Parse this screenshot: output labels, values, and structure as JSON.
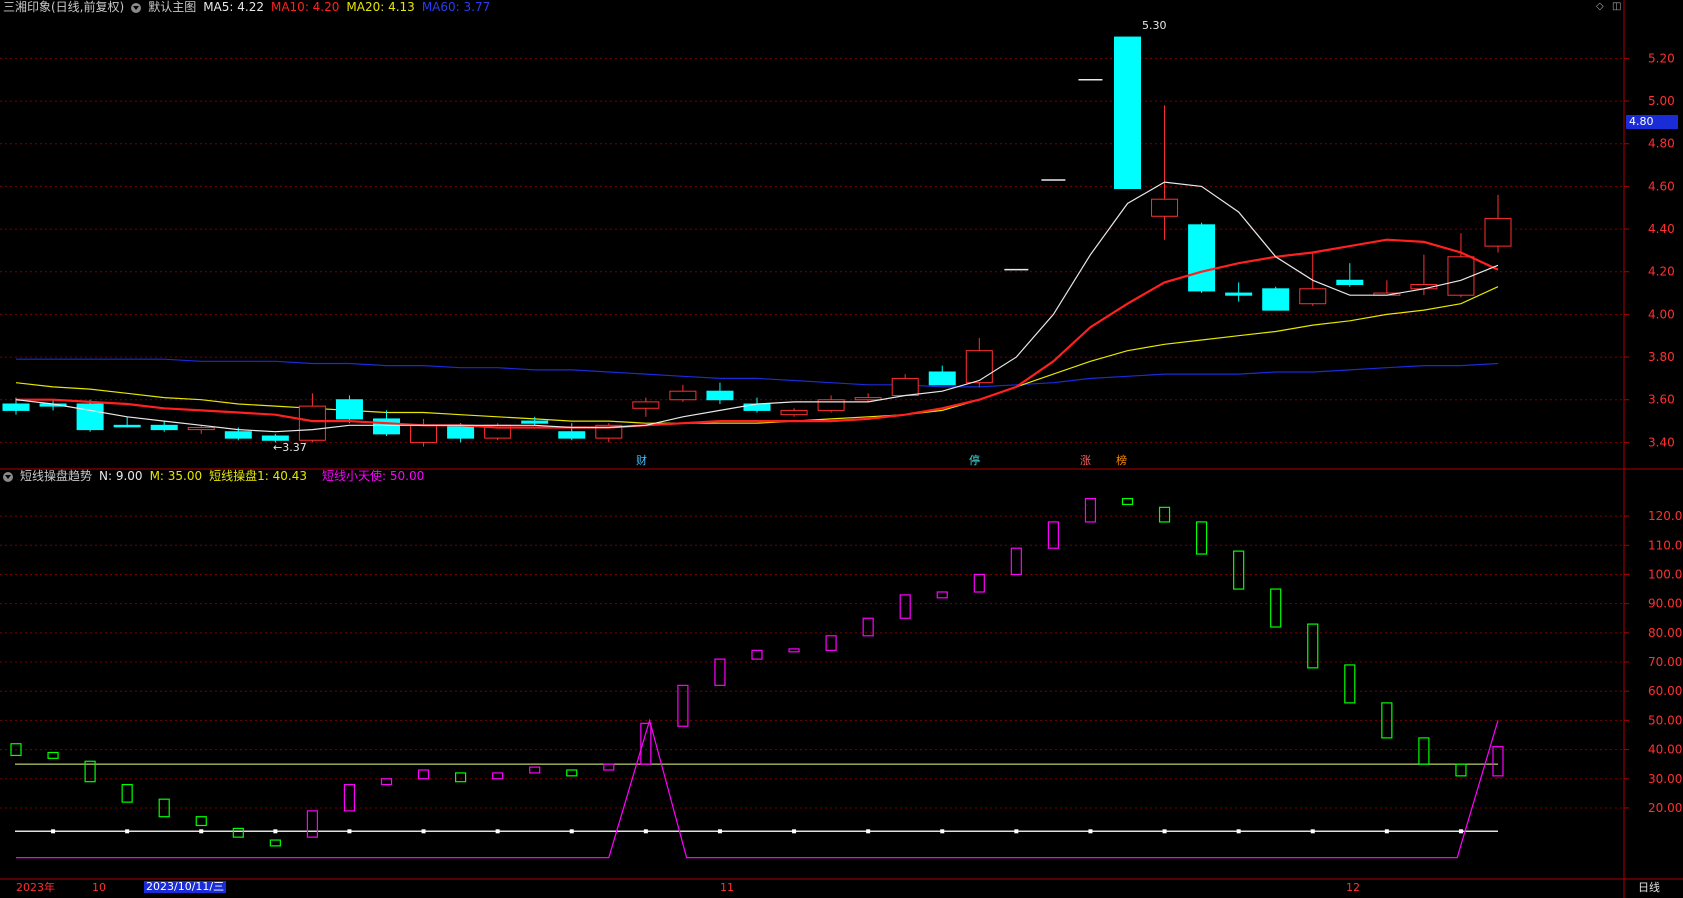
{
  "top_panel": {
    "stock_name": "三湘印象(日线,前复权)",
    "main_chart_label": "默认主图",
    "ma5": "MA5: 4.22",
    "ma10": "MA10: 4.20",
    "ma20": "MA20: 4.13",
    "ma60": "MA60: 3.77",
    "current_price_tag": "4.80",
    "high_label": "5.30",
    "low_label": "←3.37",
    "event_markers": [
      "财",
      "停",
      "涨",
      "榜"
    ]
  },
  "bottom_panel": {
    "indicator_name": "短线操盘趋势",
    "n": "N: 9.00",
    "m": "M: 35.00",
    "trade_line": "短线操盘1: 40.43",
    "angel": "短线小天使: 50.00"
  },
  "time_axis": {
    "labels": [
      "2023年",
      "10",
      "2023/10/11/三",
      "11",
      "12"
    ],
    "period": "日线"
  },
  "colors": {
    "up": "#ff3030",
    "down": "#00ffff",
    "ma5": "#e8e8e8",
    "ma10": "#ff2020",
    "ma20": "#e6e600",
    "ma60": "#1a2bd8",
    "ind_up": "#ff00ff",
    "ind_down": "#00ff00",
    "grid": "#7a0000",
    "axis_text": "#ff3030"
  },
  "chart_data": [
    {
      "type": "candlestick",
      "yticks": [
        3.4,
        3.6,
        3.8,
        4.0,
        4.2,
        4.4,
        4.6,
        4.8,
        5.0,
        5.2
      ],
      "ylim": [
        3.28,
        5.38
      ],
      "candles": [
        [
          3.58,
          3.61,
          3.53,
          3.55
        ],
        [
          3.58,
          3.6,
          3.55,
          3.57
        ],
        [
          3.58,
          3.6,
          3.45,
          3.46
        ],
        [
          3.48,
          3.52,
          3.47,
          3.48
        ],
        [
          3.48,
          3.5,
          3.45,
          3.46
        ],
        [
          3.46,
          3.48,
          3.44,
          3.47
        ],
        [
          3.45,
          3.47,
          3.41,
          3.42
        ],
        [
          3.43,
          3.44,
          3.4,
          3.41
        ],
        [
          3.41,
          3.63,
          3.4,
          3.57
        ],
        [
          3.6,
          3.62,
          3.49,
          3.51
        ],
        [
          3.51,
          3.55,
          3.43,
          3.44
        ],
        [
          3.4,
          3.51,
          3.38,
          3.48
        ],
        [
          3.48,
          3.49,
          3.4,
          3.42
        ],
        [
          3.42,
          3.49,
          3.41,
          3.48
        ],
        [
          3.5,
          3.52,
          3.48,
          3.49
        ],
        [
          3.45,
          3.49,
          3.41,
          3.42
        ],
        [
          3.42,
          3.49,
          3.4,
          3.48
        ],
        [
          3.56,
          3.61,
          3.52,
          3.59
        ],
        [
          3.6,
          3.67,
          3.59,
          3.64
        ],
        [
          3.64,
          3.68,
          3.58,
          3.6
        ],
        [
          3.58,
          3.61,
          3.54,
          3.55
        ],
        [
          3.53,
          3.56,
          3.52,
          3.55
        ],
        [
          3.55,
          3.62,
          3.54,
          3.6
        ],
        [
          3.6,
          3.63,
          3.59,
          3.61
        ],
        [
          3.62,
          3.72,
          3.62,
          3.7
        ],
        [
          3.73,
          3.76,
          3.67,
          3.67
        ],
        [
          3.68,
          3.89,
          3.66,
          3.83
        ],
        [
          4.21,
          4.21,
          4.21,
          4.21
        ],
        [
          4.63,
          4.63,
          4.63,
          4.63
        ],
        [
          5.1,
          5.1,
          5.1,
          5.1
        ],
        [
          5.3,
          5.3,
          4.59,
          4.59
        ],
        [
          4.46,
          4.98,
          4.35,
          4.54
        ],
        [
          4.42,
          4.43,
          4.1,
          4.11
        ],
        [
          4.1,
          4.15,
          4.06,
          4.09
        ],
        [
          4.12,
          4.13,
          4.02,
          4.02
        ],
        [
          4.05,
          4.29,
          4.04,
          4.12
        ],
        [
          4.16,
          4.24,
          4.13,
          4.14
        ],
        [
          4.09,
          4.16,
          4.09,
          4.1
        ],
        [
          4.12,
          4.28,
          4.09,
          4.14
        ],
        [
          4.09,
          4.38,
          4.08,
          4.27
        ],
        [
          4.32,
          4.56,
          4.29,
          4.45
        ]
      ],
      "ma5": [
        3.6,
        3.58,
        3.55,
        3.52,
        3.5,
        3.48,
        3.46,
        3.45,
        3.46,
        3.48,
        3.48,
        3.48,
        3.48,
        3.48,
        3.48,
        3.47,
        3.47,
        3.48,
        3.52,
        3.55,
        3.58,
        3.59,
        3.59,
        3.59,
        3.62,
        3.64,
        3.69,
        3.8,
        4.0,
        4.28,
        4.52,
        4.62,
        4.6,
        4.48,
        4.27,
        4.16,
        4.09,
        4.09,
        4.12,
        4.16,
        4.23
      ],
      "ma10": [
        3.6,
        3.6,
        3.59,
        3.58,
        3.56,
        3.55,
        3.54,
        3.53,
        3.5,
        3.5,
        3.49,
        3.48,
        3.48,
        3.47,
        3.47,
        3.47,
        3.47,
        3.48,
        3.49,
        3.5,
        3.5,
        3.5,
        3.5,
        3.51,
        3.53,
        3.56,
        3.6,
        3.66,
        3.78,
        3.94,
        4.05,
        4.15,
        4.2,
        4.24,
        4.27,
        4.29,
        4.32,
        4.35,
        4.34,
        4.29,
        4.21
      ],
      "ma20": [
        3.68,
        3.66,
        3.65,
        3.63,
        3.61,
        3.6,
        3.58,
        3.57,
        3.56,
        3.55,
        3.54,
        3.54,
        3.53,
        3.52,
        3.51,
        3.5,
        3.5,
        3.49,
        3.49,
        3.49,
        3.49,
        3.5,
        3.51,
        3.52,
        3.53,
        3.55,
        3.6,
        3.66,
        3.72,
        3.78,
        3.83,
        3.86,
        3.88,
        3.9,
        3.92,
        3.95,
        3.97,
        4.0,
        4.02,
        4.05,
        4.13
      ],
      "ma60": [
        3.79,
        3.79,
        3.79,
        3.79,
        3.79,
        3.78,
        3.78,
        3.78,
        3.77,
        3.77,
        3.76,
        3.76,
        3.75,
        3.75,
        3.74,
        3.74,
        3.73,
        3.72,
        3.71,
        3.7,
        3.7,
        3.69,
        3.68,
        3.67,
        3.67,
        3.66,
        3.66,
        3.67,
        3.68,
        3.7,
        3.71,
        3.72,
        3.72,
        3.72,
        3.73,
        3.73,
        3.74,
        3.75,
        3.76,
        3.76,
        3.77
      ]
    },
    {
      "type": "indicator",
      "yticks": [
        20,
        30,
        40,
        50,
        60,
        70,
        80,
        90,
        100,
        110,
        120
      ],
      "ylim": [
        -4,
        131
      ],
      "boxes": [
        [
          42,
          38,
          "d"
        ],
        [
          39,
          37,
          "d"
        ],
        [
          36,
          29,
          "d"
        ],
        [
          28,
          22,
          "d"
        ],
        [
          23,
          17,
          "d"
        ],
        [
          17,
          14,
          "d"
        ],
        [
          13,
          10,
          "d"
        ],
        [
          9,
          7,
          "d"
        ],
        [
          10,
          19,
          "u"
        ],
        [
          19,
          28,
          "u"
        ],
        [
          28,
          30,
          "u"
        ],
        [
          30,
          33,
          "u"
        ],
        [
          32,
          29,
          "d"
        ],
        [
          30,
          32,
          "u"
        ],
        [
          32,
          34,
          "u"
        ],
        [
          33,
          31,
          "d"
        ],
        [
          33,
          35,
          "u"
        ],
        [
          35,
          49,
          "u"
        ],
        [
          48,
          62,
          "u"
        ],
        [
          62,
          71,
          "u"
        ],
        [
          71,
          74,
          "u"
        ],
        [
          73.5,
          74.5,
          "u"
        ],
        [
          74,
          79,
          "u"
        ],
        [
          79,
          85,
          "u"
        ],
        [
          85,
          93,
          "u"
        ],
        [
          92,
          94,
          "u"
        ],
        [
          94,
          100,
          "u"
        ],
        [
          100,
          109,
          "u"
        ],
        [
          109,
          118,
          "u"
        ],
        [
          118,
          126,
          "u"
        ],
        [
          126,
          124,
          "d"
        ],
        [
          123,
          118,
          "d"
        ],
        [
          118,
          107,
          "d"
        ],
        [
          108,
          95,
          "d"
        ],
        [
          95,
          82,
          "d"
        ],
        [
          83,
          68,
          "d"
        ],
        [
          69,
          56,
          "d"
        ],
        [
          56,
          44,
          "d"
        ],
        [
          44,
          35,
          "d"
        ],
        [
          35,
          31,
          "d"
        ],
        [
          31,
          41,
          "u"
        ]
      ],
      "hline_level": 35,
      "dots_level": 12,
      "angel_line": [
        [
          0,
          3
        ],
        [
          16,
          3
        ],
        [
          17.1,
          50
        ],
        [
          18.1,
          3
        ],
        [
          38.9,
          3
        ],
        [
          40,
          50
        ]
      ]
    }
  ]
}
